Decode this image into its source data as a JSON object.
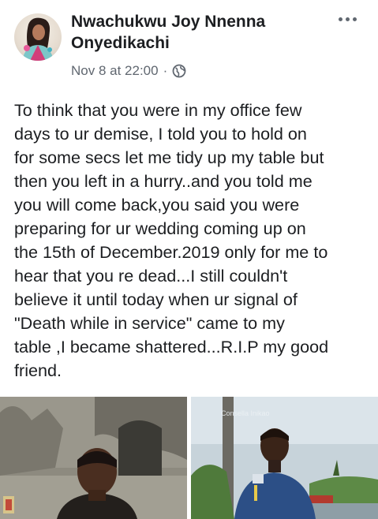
{
  "post": {
    "author": "Nwachukwu Joy Nnenna Onyedikachi",
    "timestamp": "Nov 8 at 22:00",
    "separator": "·",
    "privacy_icon": "globe-icon",
    "more_icon": "more-options-icon",
    "text": "To think that you were in my office few\ndays to ur demise, I told you to hold on\nfor some secs let me tidy up my table but\nthen you left in a hurry..and you told me\nyou will come back,you said you were\npreparing for ur wedding coming up on\nthe 15th of December.2019 only for me to\nhear that you re dead...I still couldn't\nbelieve it until today when ur signal of\n\"Death while in service\" came to my\ntable ,I became shattered...R.I.P my good\nfriend."
  },
  "photos": {
    "right_watermark": "Consella Inikao"
  },
  "colors": {
    "text_primary": "#1c1e21",
    "text_secondary": "#606770",
    "background": "#ffffff"
  }
}
